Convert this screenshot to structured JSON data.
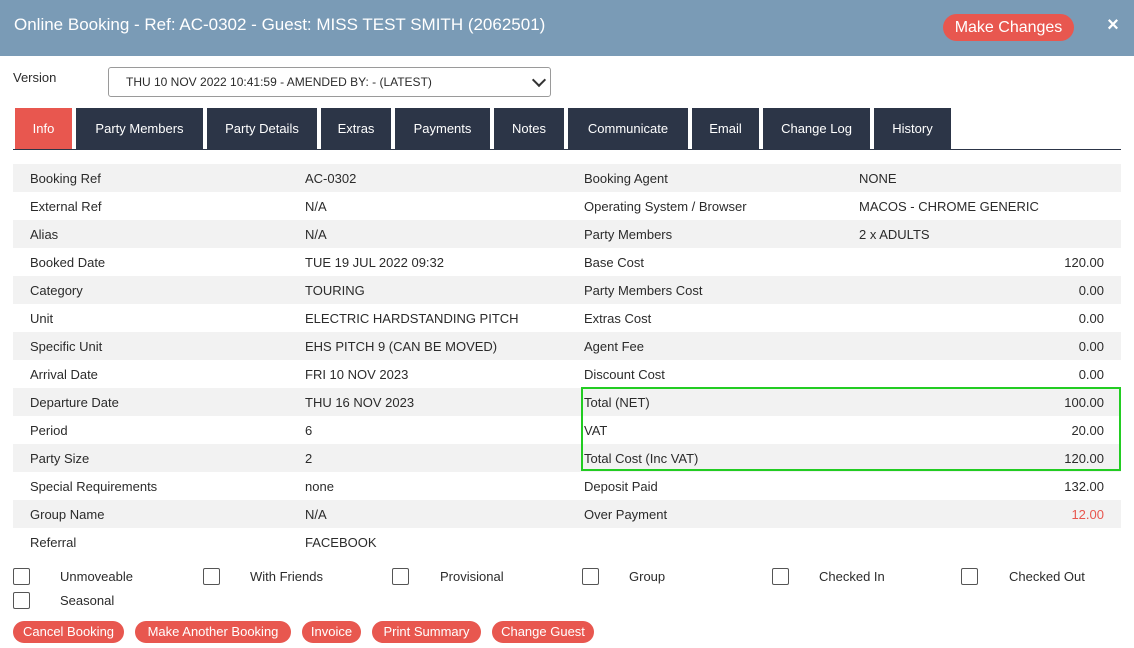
{
  "header": {
    "title": "Online Booking - Ref: AC-0302 - Guest: MISS TEST SMITH (2062501)",
    "make_changes": "Make Changes",
    "close": "×"
  },
  "version": {
    "label": "Version",
    "selected": "THU 10 NOV 2022 10:41:59 - AMENDED BY: - (LATEST)"
  },
  "tabs": [
    {
      "label": "Info",
      "active": true
    },
    {
      "label": "Party Members"
    },
    {
      "label": "Party Details"
    },
    {
      "label": "Extras"
    },
    {
      "label": "Payments"
    },
    {
      "label": "Notes"
    },
    {
      "label": "Communicate"
    },
    {
      "label": "Email"
    },
    {
      "label": "Change Log"
    },
    {
      "label": "History"
    }
  ],
  "details": [
    {
      "label": "Booking Ref",
      "value": "AC-0302",
      "label2": "Booking Agent",
      "value2": "NONE"
    },
    {
      "label": "External Ref",
      "value": "N/A",
      "label2": "Operating System / Browser",
      "value2": "MACOS - CHROME GENERIC"
    },
    {
      "label": "Alias",
      "value": "N/A",
      "label2": "Party Members",
      "value2": "2 x ADULTS"
    },
    {
      "label": "Booked Date",
      "value": "TUE 19 JUL 2022 09:32",
      "label2": "Base Cost",
      "value2": "120.00"
    },
    {
      "label": "Category",
      "value": "TOURING",
      "label2": "Party Members Cost",
      "value2": "0.00"
    },
    {
      "label": "Unit",
      "value": "ELECTRIC HARDSTANDING PITCH",
      "label2": "Extras Cost",
      "value2": "0.00"
    },
    {
      "label": "Specific Unit",
      "value": "EHS PITCH 9 (CAN BE MOVED)",
      "label2": "Agent Fee",
      "value2": "0.00"
    },
    {
      "label": "Arrival Date",
      "value": "FRI 10 NOV 2023",
      "label2": "Discount Cost",
      "value2": "0.00"
    },
    {
      "label": "Departure Date",
      "value": "THU 16 NOV 2023",
      "label2": "Total (NET)",
      "value2": "100.00"
    },
    {
      "label": "Period",
      "value": "6",
      "label2": "VAT",
      "value2": "20.00"
    },
    {
      "label": "Party Size",
      "value": "2",
      "label2": "Total Cost (Inc VAT)",
      "value2": "120.00"
    },
    {
      "label": "Special Requirements",
      "value": "none",
      "label2": "Deposit Paid",
      "value2": "132.00"
    },
    {
      "label": "Group Name",
      "value": "N/A",
      "label2": "Over Payment",
      "value2": "12.00"
    },
    {
      "label": "Referral",
      "value": "FACEBOOK",
      "label2": "",
      "value2": ""
    }
  ],
  "flags": [
    "Unmoveable",
    "With Friends",
    "Provisional",
    "Group",
    "Checked In",
    "Checked Out",
    "Seasonal"
  ],
  "actions": [
    "Cancel Booking",
    "Make Another Booking",
    "Invoice",
    "Print Summary",
    "Change Guest"
  ],
  "colors": {
    "header": "#7a9bb6",
    "accent": "#e8574f",
    "tab": "#2c3547",
    "highlight": "#22cc22"
  }
}
